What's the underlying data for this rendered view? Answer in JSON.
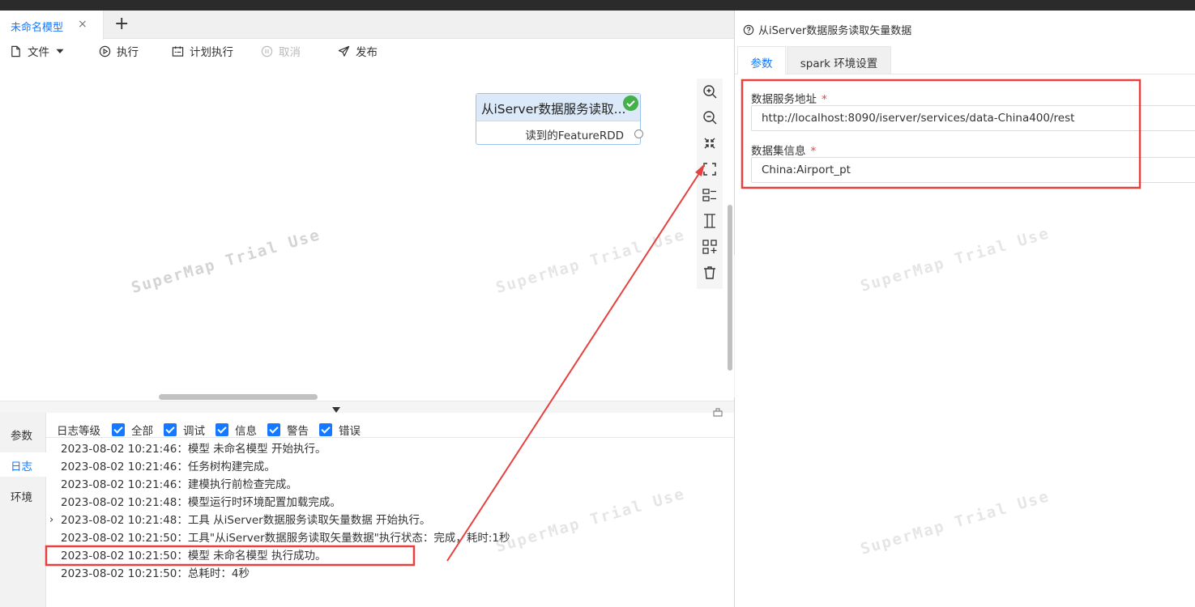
{
  "document_tab": {
    "label": "未命名模型",
    "close": "×",
    "add": "+"
  },
  "toolbar": {
    "file": "文件",
    "run": "执行",
    "schedule": "计划执行",
    "cancel": "取消",
    "publish": "发布"
  },
  "node": {
    "title": "从iServer数据服务读取...",
    "output": "读到的FeatureRDD",
    "status": "success"
  },
  "side_tools": [
    "zoom-in-icon",
    "zoom-out-icon",
    "fit-view-icon",
    "fullscreen-icon",
    "align-horizontal-icon",
    "align-vertical-icon",
    "add-node-icon",
    "delete-icon"
  ],
  "bottom_tabs": [
    "参数",
    "日志",
    "环境"
  ],
  "log_filter": {
    "label": "日志等级",
    "levels": [
      "全部",
      "调试",
      "信息",
      "警告",
      "错误"
    ]
  },
  "log_lines": [
    "2023-08-02 10:21:46：模型 未命名模型 开始执行。",
    "2023-08-02 10:21:46：任务树构建完成。",
    "2023-08-02 10:21:46：建模执行前检查完成。",
    "2023-08-02 10:21:48：模型运行时环境配置加载完成。",
    "2023-08-02 10:21:48：工具 从iServer数据服务读取矢量数据 开始执行。",
    "2023-08-02 10:21:50：工具\"从iServer数据服务读取矢量数据\"执行状态：完成，耗时:1秒",
    "2023-08-02 10:21:50：模型 未命名模型 执行成功。",
    "2023-08-02 10:21:50：总耗时：4秒"
  ],
  "right_panel": {
    "title": "从iServer数据服务读取矢量数据",
    "tabs": [
      "参数",
      "spark 环境设置"
    ],
    "fields": [
      {
        "label": "数据服务地址",
        "required": "*",
        "value": "http://localhost:8090/iserver/services/data-China400/rest"
      },
      {
        "label": "数据集信息",
        "required": "*",
        "value": "China:Airport_pt"
      }
    ]
  },
  "watermark": "SuperMap Trial Use",
  "colors": {
    "accent": "#1677ff",
    "highlight": "#e5413e",
    "success": "#43b04a"
  }
}
